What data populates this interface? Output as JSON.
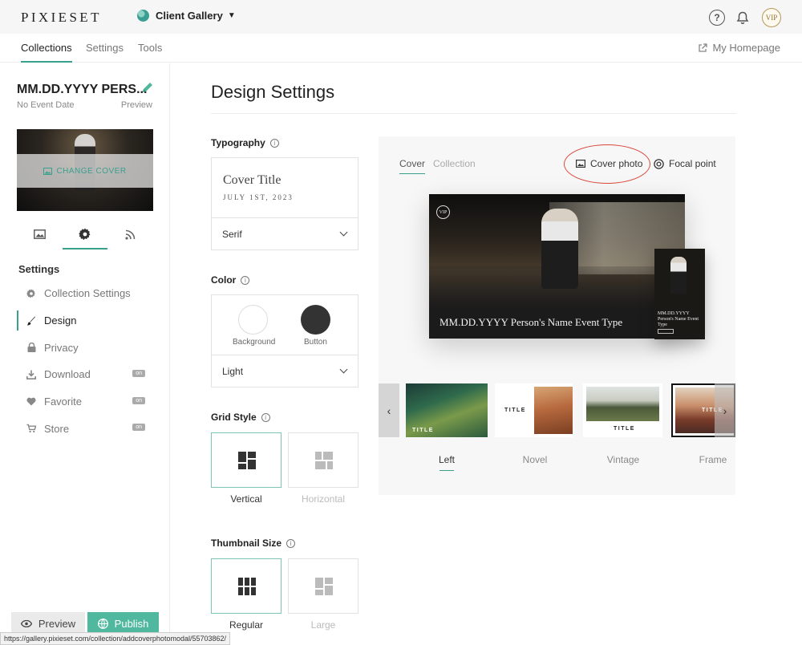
{
  "topbar": {
    "logo": "PIXIESET",
    "gallery_switch": "Client Gallery",
    "avatar": "VIP"
  },
  "subnav": {
    "tabs": [
      "Collections",
      "Settings",
      "Tools"
    ],
    "my_homepage": "My Homepage"
  },
  "sidebar": {
    "collection_title": "MM.DD.YYYY PERS...",
    "event_date": "No Event Date",
    "preview_link": "Preview",
    "change_cover": "CHANGE COVER",
    "settings_heading": "Settings",
    "menu": [
      {
        "label": "Collection Settings",
        "icon": "gear-icon",
        "badge": ""
      },
      {
        "label": "Design",
        "icon": "brush-icon",
        "badge": ""
      },
      {
        "label": "Privacy",
        "icon": "lock-icon",
        "badge": ""
      },
      {
        "label": "Download",
        "icon": "download-icon",
        "badge": "on"
      },
      {
        "label": "Favorite",
        "icon": "heart-icon",
        "badge": "on"
      },
      {
        "label": "Store",
        "icon": "cart-icon",
        "badge": "on"
      }
    ],
    "preview_button": "Preview",
    "publish_button": "Publish"
  },
  "status_url": "https://gallery.pixieset.com/collection/addcoverphotomodal/55703862/",
  "main": {
    "title": "Design Settings",
    "typography": {
      "heading": "Typography",
      "cover_title": "Cover Title",
      "cover_date": "JULY 1ST, 2023",
      "font_value": "Serif"
    },
    "color": {
      "heading": "Color",
      "background_label": "Background",
      "button_label": "Button",
      "theme_value": "Light"
    },
    "grid_style": {
      "heading": "Grid Style",
      "options": [
        "Vertical",
        "Horizontal"
      ],
      "selected": "Vertical"
    },
    "thumbnail_size": {
      "heading": "Thumbnail Size",
      "options": [
        "Regular",
        "Large"
      ],
      "selected": "Regular"
    }
  },
  "preview_panel": {
    "tabs": [
      "Cover",
      "Collection"
    ],
    "actions": {
      "cover_photo": "Cover photo",
      "focal_point": "Focal point"
    },
    "vip_mark": "VIP",
    "desktop_title": "MM.DD.YYYY Person's Name Event Type",
    "mobile_title": "MM.DD.YYYY Person's Name Event Type",
    "card_label": "TITLE",
    "styles": [
      "Left",
      "Novel",
      "Vintage",
      "Frame"
    ],
    "selected_style": "Left"
  },
  "colors": {
    "accent": "#3aa08e",
    "publish": "#4fb89e",
    "highlight_circle": "#d9483b"
  }
}
